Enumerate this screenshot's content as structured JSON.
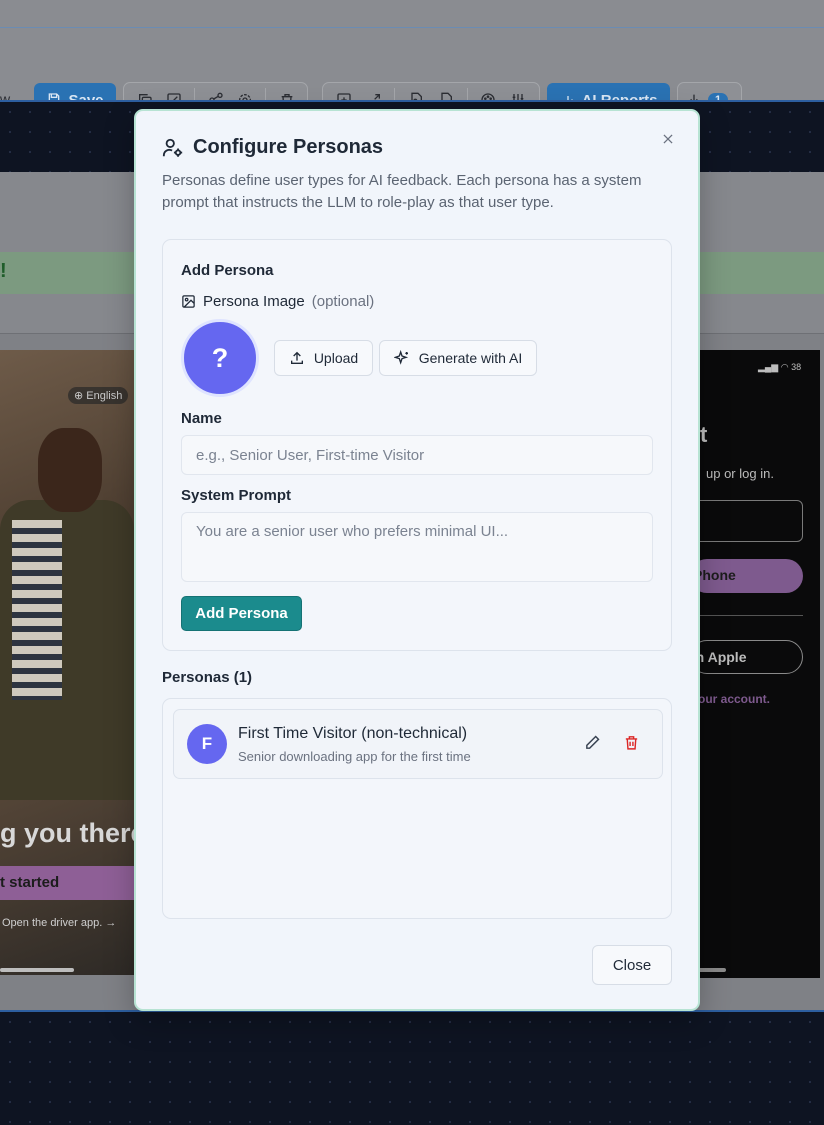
{
  "toolbar": {
    "left_fragment": "w",
    "save_label": "Save",
    "ai_reports_label": "AI Reports",
    "download_badge": "1"
  },
  "background": {
    "banner_fragment": "!",
    "left_phone": {
      "language": "English",
      "headline": "g you there",
      "cta": "t started",
      "sub": "Open the driver app."
    },
    "right_phone": {
      "status": "38",
      "title_fragment": "t",
      "subtitle_fragment": "up or log in.",
      "phone_button": "Phone",
      "apple_button": "th Apple",
      "account_link": "our account."
    }
  },
  "modal": {
    "title": "Configure Personas",
    "description": "Personas define user types for AI feedback. Each persona has a system prompt that instructs the LLM to role-play as that user type.",
    "close_icon": "x-icon",
    "add_section": {
      "heading": "Add Persona",
      "image_label": "Persona Image",
      "image_optional": "(optional)",
      "avatar_placeholder": "?",
      "upload_label": "Upload",
      "generate_label": "Generate with AI",
      "name_label": "Name",
      "name_placeholder": "e.g., Senior User, First-time Visitor",
      "name_value": "",
      "prompt_label": "System Prompt",
      "prompt_placeholder": "You are a senior user who prefers minimal UI...",
      "prompt_value": "",
      "submit_label": "Add Persona"
    },
    "personas_heading": "Personas (1)",
    "personas": [
      {
        "initial": "F",
        "name": "First Time Visitor (non-technical)",
        "description": "Senior downloading app for the first time"
      }
    ],
    "close_button": "Close"
  },
  "colors": {
    "accent": "#1b8b8d",
    "avatar": "#6567f0",
    "delete": "#dc2626",
    "toolbar_primary": "#2a72b3"
  }
}
